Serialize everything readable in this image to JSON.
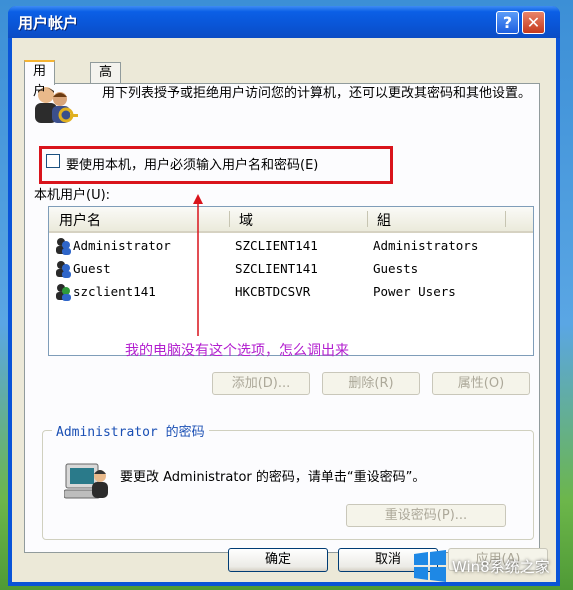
{
  "window": {
    "title": "用户帐户",
    "help": "?",
    "close": "✕"
  },
  "tabs": [
    {
      "label": "用户"
    },
    {
      "label": "高级"
    }
  ],
  "intro": {
    "text": "用下列表授予或拒绝用户访问您的计算机，还可以更改其密码和其他设置。"
  },
  "checkbox": {
    "label": "要使用本机，用户必须输入用户名和密码(E)",
    "checked": false
  },
  "users_section": {
    "label": "本机用户(U):"
  },
  "table": {
    "columns": [
      "用户名",
      "域",
      "組"
    ],
    "rows": [
      {
        "name": "Administrator",
        "domain": "SZCLIENT141",
        "group": "Administrators"
      },
      {
        "name": "Guest",
        "domain": "SZCLIENT141",
        "group": "Guests"
      },
      {
        "name": "szclient141",
        "domain": "HKCBTDCSVR",
        "group": "Power Users"
      }
    ]
  },
  "annotation": {
    "text": "我的电脑没有这个选项，怎么调出来",
    "color": "#b21ecf",
    "box_color": "#d9141c"
  },
  "buttons": {
    "add": "添加(D)...",
    "remove": "删除(R)",
    "properties": "属性(O)"
  },
  "password_group": {
    "title": "Administrator 的密码",
    "text": "要更改 Administrator 的密码，请单击“重设密码”。",
    "reset": "重设密码(P)..."
  },
  "footer": {
    "ok": "确定",
    "cancel": "取消",
    "apply": "应用(A)"
  },
  "watermark": {
    "text": "Win8系统之家"
  }
}
